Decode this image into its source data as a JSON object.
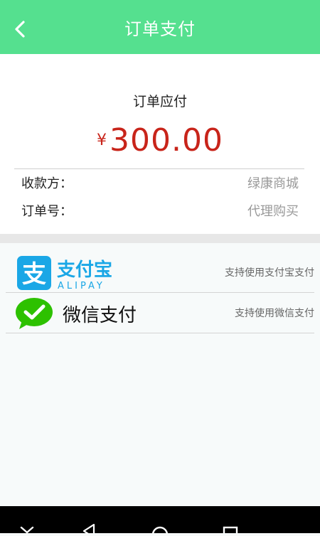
{
  "header": {
    "title": "订单支付"
  },
  "order": {
    "amount_label": "订单应付",
    "currency": "¥",
    "amount": "300.00",
    "payee_label": "收款方：",
    "payee_value": "绿康商城",
    "order_no_label": "订单号：",
    "order_no_value": "代理购买"
  },
  "payment_methods": [
    {
      "logo_text": "支付宝",
      "logo_sub": "ALIPAY",
      "description": "支持使用支付宝支付"
    },
    {
      "name": "微信支付",
      "description": "支持使用微信支付"
    }
  ],
  "colors": {
    "accent": "#55e08f",
    "amount": "#c8241a",
    "alipay_blue": "#1aa7e6",
    "wechat_green": "#2dc100"
  },
  "icons": {
    "back": "back-arrow-icon",
    "alipay": "alipay-logo-icon",
    "wechat": "wechat-logo-icon",
    "nav_down": "chevron-down-icon",
    "nav_back": "triangle-back-icon",
    "nav_home": "circle-home-icon",
    "nav_recent": "square-recent-icon"
  }
}
